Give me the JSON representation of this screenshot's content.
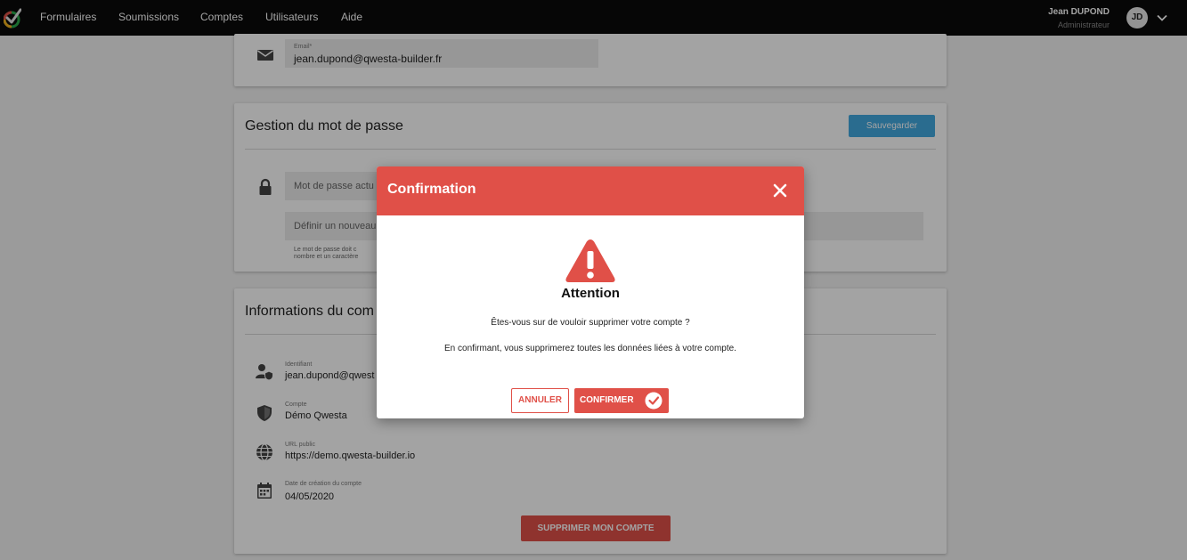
{
  "nav": {
    "items": [
      "Formulaires",
      "Soumissions",
      "Comptes",
      "Utilisateurs",
      "Aide"
    ],
    "user_name": "Jean DUPOND",
    "user_role": "Administrateur",
    "avatar_initials": "JD"
  },
  "email_card": {
    "label": "Email*",
    "value": "jean.dupond@qwesta-builder.fr",
    "icon": "envelope-icon"
  },
  "password_card": {
    "title": "Gestion du mot de passe",
    "save_label": "Sauvegarder",
    "current_placeholder": "Mot de passe actu",
    "new_placeholder": "Définir un nouveau",
    "hint_line1": "Le mot de passe doit c",
    "hint_line2": "nombre et un caractère",
    "icon": "lock-icon"
  },
  "info_card": {
    "title": "Informations du com",
    "fields": [
      {
        "label": "Identifiant",
        "value": "jean.dupond@qwest",
        "icon": "user-shield-icon"
      },
      {
        "label": "Compte",
        "value": "Démo Qwesta",
        "icon": "shield-icon"
      },
      {
        "label": "URL public",
        "value": "https://demo.qwesta-builder.io",
        "icon": "globe-icon"
      },
      {
        "label": "Date de création du compte",
        "value": "04/05/2020",
        "icon": "calendar-icon"
      }
    ],
    "delete_label": "SUPPRIMER MON COMPTE"
  },
  "modal": {
    "title": "Confirmation",
    "heading": "Attention",
    "message1": "Êtes-vous sur de vouloir supprimer votre compte ?",
    "message2": "En confirmant, vous supprimerez toutes les données liées à votre compte.",
    "cancel_label": "ANNULER",
    "confirm_label": "CONFIRMER"
  },
  "colors": {
    "accent_red": "#e05048",
    "accent_blue": "#43a9e0",
    "nav_bg": "#0a0a0a"
  }
}
